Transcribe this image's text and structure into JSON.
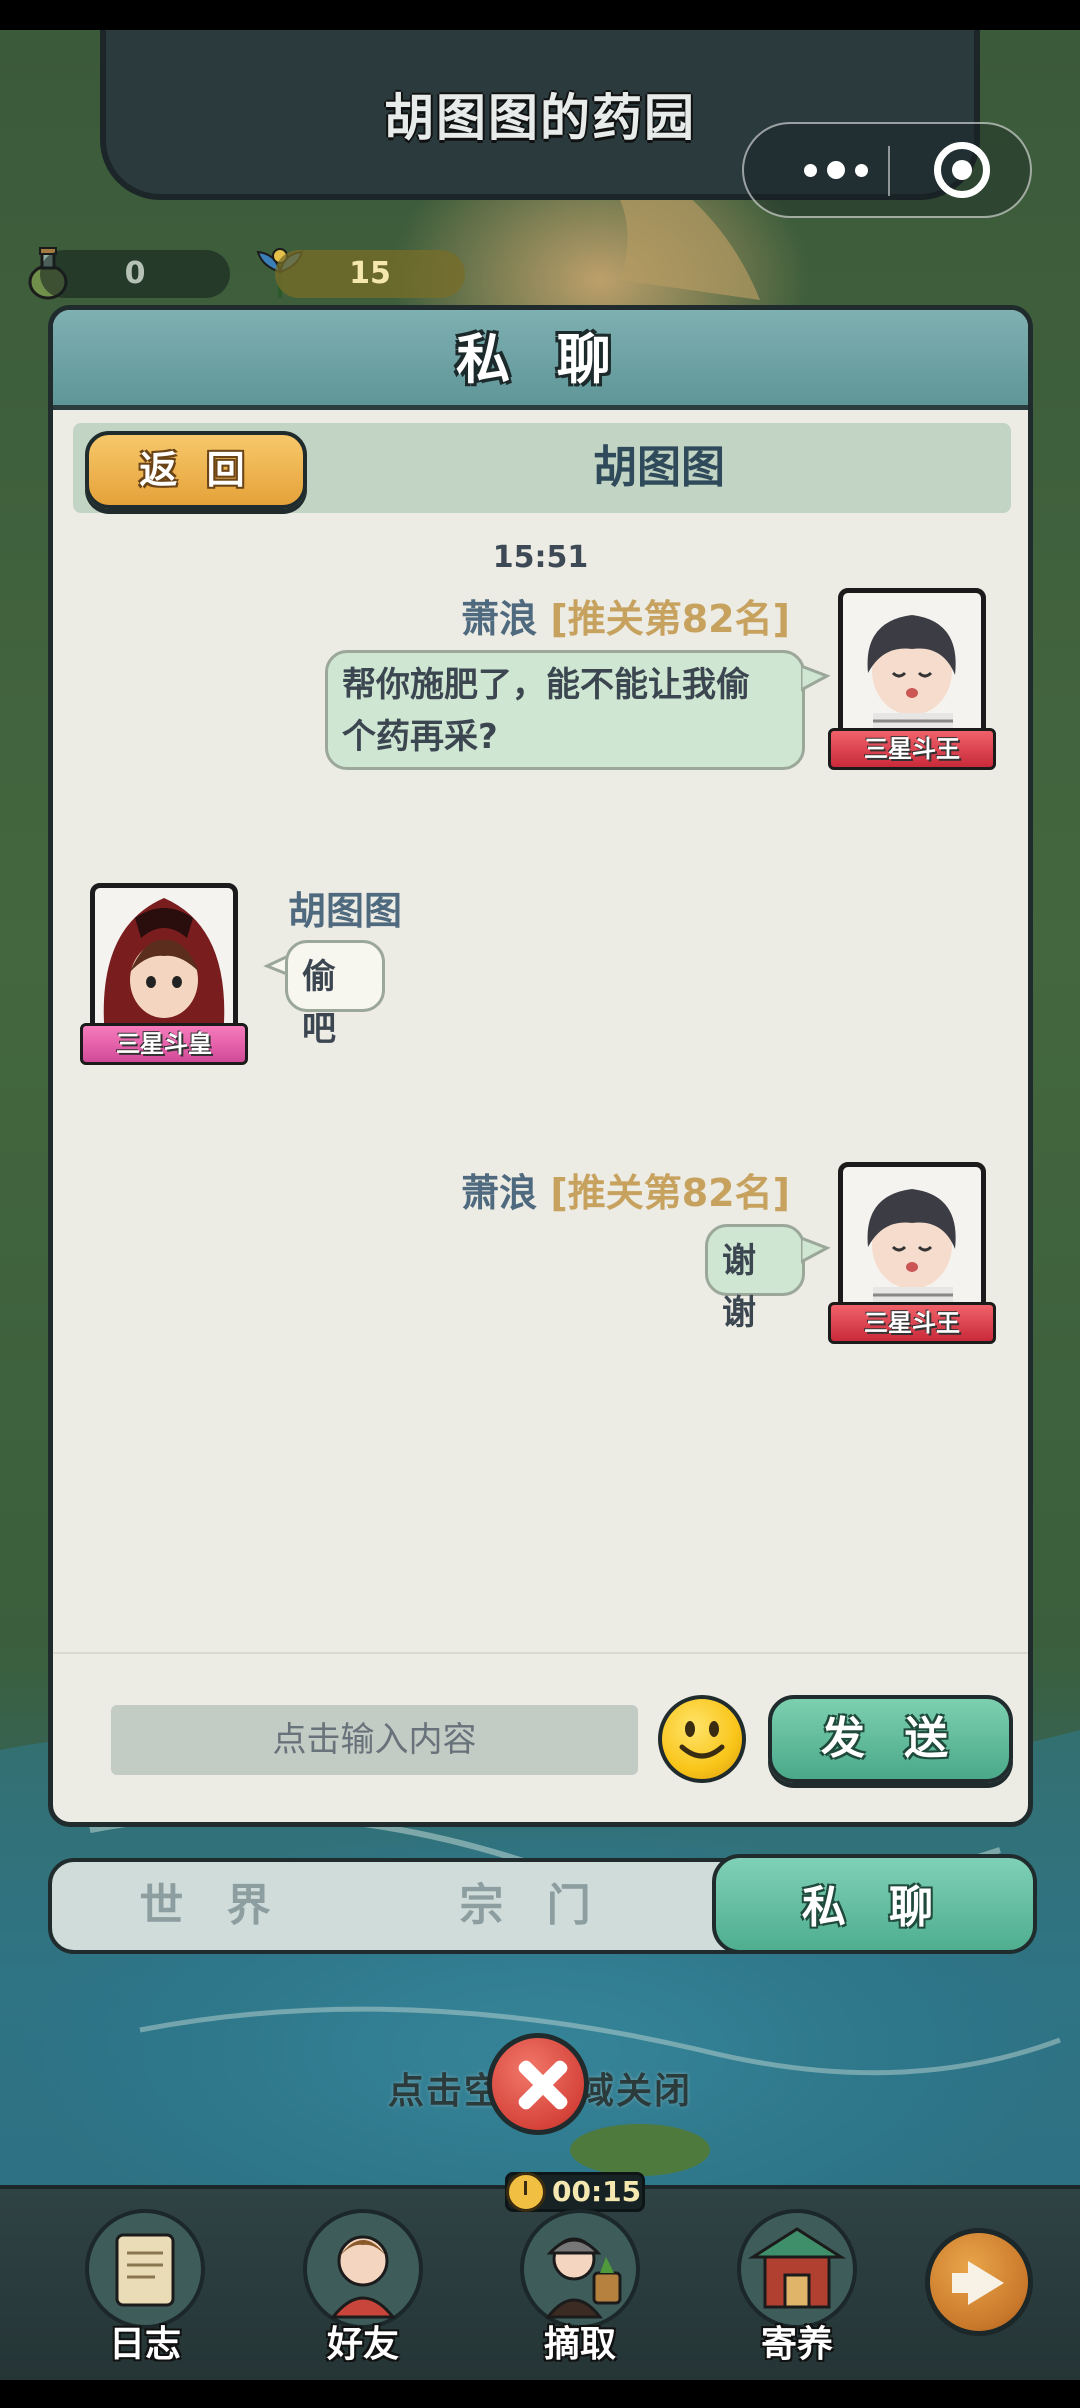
{
  "app": {
    "title": "胡图图的药园"
  },
  "resources": {
    "potion": "0",
    "herb": "15"
  },
  "panel": {
    "title": "私 聊",
    "back_label": "返 回",
    "partner_name": "胡图图"
  },
  "messages": [
    {
      "time": "15:51"
    },
    {
      "sender": "萧浪",
      "rank": "[推关第82名]",
      "text_line1": "帮你施肥了，能不能让我偷",
      "text_line2": "个药再采?",
      "badge": "三星斗王"
    },
    {
      "sender": "胡图图",
      "text": "偷吧",
      "badge": "三星斗皇"
    },
    {
      "sender": "萧浪",
      "rank": "[推关第82名]",
      "text": "谢谢",
      "badge": "三星斗王"
    }
  ],
  "composer": {
    "placeholder": "点击输入内容",
    "send_label": "发 送"
  },
  "tabs": {
    "world": "世 界",
    "sect": "宗 门",
    "private": "私 聊"
  },
  "hint": "点击空白区域关闭",
  "timer": "00:15",
  "nav": [
    {
      "label": "日志"
    },
    {
      "label": "好友"
    },
    {
      "label": "摘取"
    },
    {
      "label": "寄养"
    }
  ],
  "colors": {
    "accent_green": "#4fae8f",
    "panel_bg": "#ecebe4",
    "rank_gold": "#c7a25f"
  }
}
